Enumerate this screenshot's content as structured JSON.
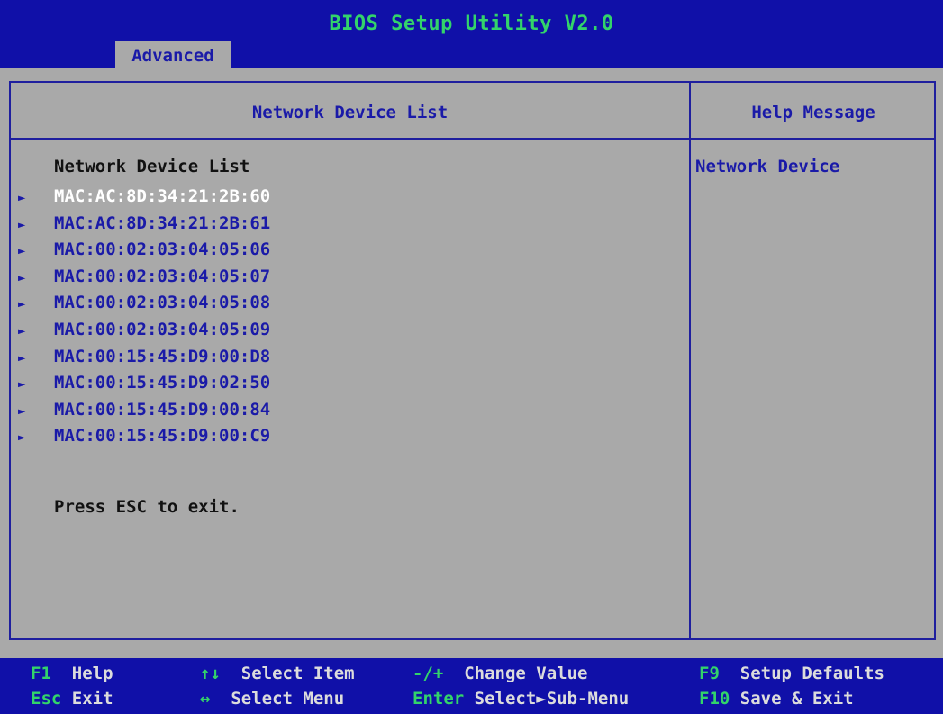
{
  "header": {
    "title": "BIOS Setup Utility V2.0",
    "active_tab": "Advanced"
  },
  "left_panel": {
    "title": "Network Device List",
    "heading": "Network Device List",
    "arrow_glyph": "►",
    "items": [
      {
        "label": "MAC:AC:8D:34:21:2B:60",
        "selected": true
      },
      {
        "label": "MAC:AC:8D:34:21:2B:61",
        "selected": false
      },
      {
        "label": "MAC:00:02:03:04:05:06",
        "selected": false
      },
      {
        "label": "MAC:00:02:03:04:05:07",
        "selected": false
      },
      {
        "label": "MAC:00:02:03:04:05:08",
        "selected": false
      },
      {
        "label": "MAC:00:02:03:04:05:09",
        "selected": false
      },
      {
        "label": "MAC:00:15:45:D9:00:D8",
        "selected": false
      },
      {
        "label": "MAC:00:15:45:D9:02:50",
        "selected": false
      },
      {
        "label": "MAC:00:15:45:D9:00:84",
        "selected": false
      },
      {
        "label": "MAC:00:15:45:D9:00:C9",
        "selected": false
      }
    ],
    "exit_text": "Press ESC to exit."
  },
  "right_panel": {
    "title": "Help Message",
    "help_text": "Network Device"
  },
  "footer": {
    "hints": [
      {
        "key": "F1",
        "desc": "Help"
      },
      {
        "key": "↑↓",
        "desc": "Select Item"
      },
      {
        "key": "-/+",
        "desc": "Change Value"
      },
      {
        "key": "F9",
        "desc": "Setup Defaults"
      },
      {
        "key": "Esc",
        "desc": "Exit"
      },
      {
        "key": "↔",
        "desc": "Select Menu"
      },
      {
        "key": "Enter",
        "desc": "Select►Sub-Menu"
      },
      {
        "key": "F10",
        "desc": "Save & Exit"
      }
    ]
  },
  "colors": {
    "bar_background": "#1010a8",
    "panel_background": "#a9a9a9",
    "title_green": "#33d46a",
    "text_blue": "#1a1aa8",
    "selected_text": "#ffffff"
  }
}
